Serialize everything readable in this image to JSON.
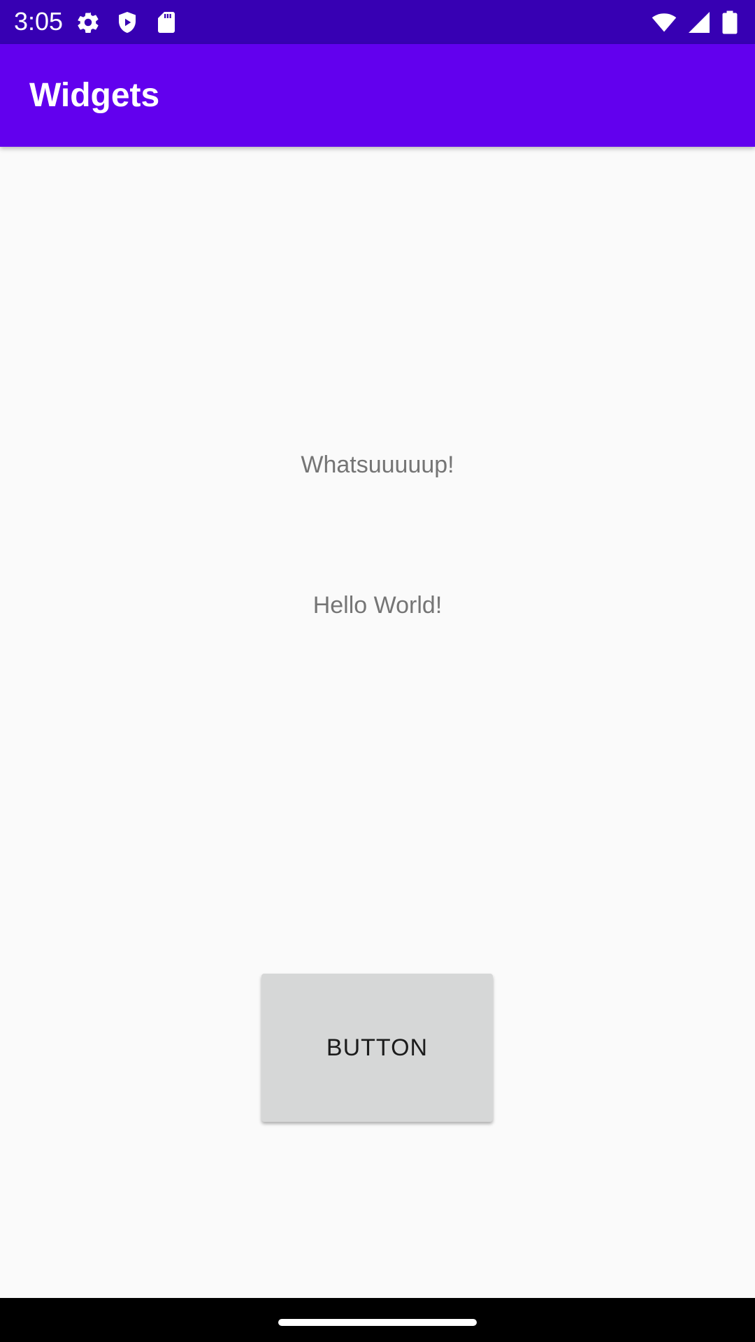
{
  "status_bar": {
    "time": "3:05",
    "background_color": "#3700b3",
    "left_icons": [
      "gear-icon",
      "shield-play-icon",
      "sd-card-icon"
    ],
    "right_icons": [
      "wifi-icon",
      "cell-signal-icon",
      "battery-icon"
    ]
  },
  "app_bar": {
    "title": "Widgets",
    "background_color": "#6200ee"
  },
  "main": {
    "text_1": "Whatsuuuuup!",
    "text_2": "Hello World!",
    "button_label": "BUTTON",
    "button_color": "#d6d7d7"
  },
  "nav_bar": {
    "background_color": "#000000",
    "home_handle": "home-handle"
  }
}
